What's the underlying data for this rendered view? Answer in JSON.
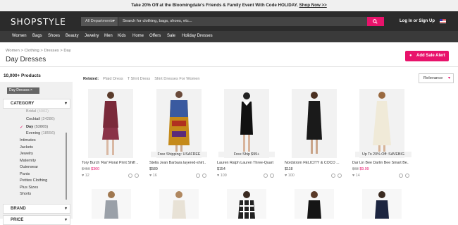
{
  "promo": {
    "text": "Take 20% Off at the Bloomingdale's Friends & Family Event With Code HOLIDAY.",
    "link": "Shop Now >>"
  },
  "header": {
    "logo": "SHOPSTYLE",
    "department": "All Departments",
    "search_placeholder": "Search for clothing, bags, shoes, etc...",
    "login": "Log In or Sign Up"
  },
  "nav": [
    "Women",
    "Bags",
    "Shoes",
    "Beauty",
    "Jewelry",
    "Men",
    "Kids",
    "Home",
    "Offers",
    "Sale",
    "Holiday Dresses"
  ],
  "breadcrumb": [
    "Women",
    "Clothing",
    "Dresses",
    "Day"
  ],
  "breadcrumb_sep": ">",
  "page_title": "Day Dresses",
  "sale_alert": "Add Sale Alert",
  "product_count": "10,000+ Products",
  "related": {
    "label": "Related:",
    "items": [
      "Plaid Dress",
      "T Shirt Dress",
      "Shirt Dresses For Women"
    ]
  },
  "sort": "Relevance",
  "filter_chip": "Day Dresses ×",
  "category": {
    "title": "CATEGORY",
    "subs": [
      {
        "name": "Bridal",
        "count": "(4002)"
      },
      {
        "name": "Cocktail",
        "count": "(24286)"
      },
      {
        "name": "Day",
        "count": "(53865)"
      },
      {
        "name": "Evening",
        "count": "(18556)"
      }
    ],
    "items": [
      "Intimates",
      "Jackets",
      "Jewelry",
      "Maternity",
      "Outerwear",
      "Pants",
      "Petites Clothing",
      "Plus Sizes",
      "Shorts"
    ]
  },
  "brand_title": "BRAND",
  "price_title": "PRICE",
  "products": [
    {
      "caption": "",
      "name": "Tory Burch 'Rai' Floral Print Shift ...",
      "old_price": "$450",
      "price": "$360",
      "favs": "12"
    },
    {
      "caption": "Free Shipping: USAFREE",
      "name": "Stella Jean Barbara layered-shirt...",
      "old_price": "",
      "price": "$589",
      "favs": "16"
    },
    {
      "caption": "Free Ship $99+",
      "name": "Lauren Ralph Lauren Three-Quart...",
      "old_price": "",
      "price": "$154",
      "favs": "109"
    },
    {
      "caption": "",
      "name": "Nordstrom FELICITY & COCO ...",
      "old_price": "",
      "price": "$118",
      "favs": "100"
    },
    {
      "caption": "Up To 20% Off: SAVEBIG",
      "name": "Dar Lin Bee Darlin Bee Smart Be...",
      "old_price": "$68",
      "price": "$9.99",
      "favs": "14"
    }
  ]
}
